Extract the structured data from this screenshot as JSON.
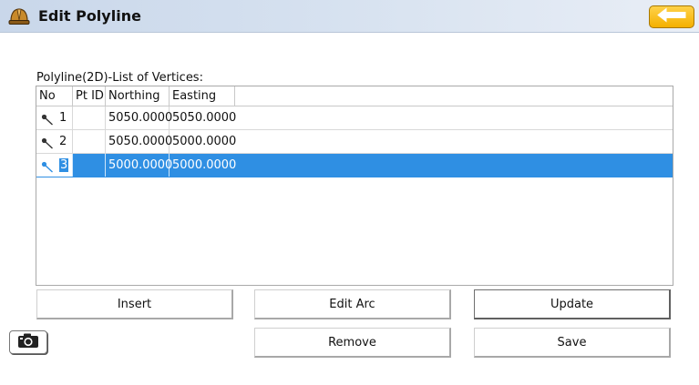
{
  "window": {
    "title": "Edit Polyline"
  },
  "list": {
    "caption": "Polyline(2D)-List of Vertices:",
    "columns": [
      "No",
      "Pt ID",
      "Northing",
      "Easting"
    ],
    "rows": [
      {
        "no": "1",
        "pt_id": "",
        "northing": "5050.0000",
        "easting": "5050.0000",
        "selected": false
      },
      {
        "no": "2",
        "pt_id": "",
        "northing": "5050.0000",
        "easting": "5000.0000",
        "selected": false
      },
      {
        "no": "3",
        "pt_id": "",
        "northing": "5000.0000",
        "easting": "5000.0000",
        "selected": true
      }
    ]
  },
  "buttons": {
    "insert": "Insert",
    "edit_arc": "Edit Arc",
    "update": "Update",
    "remove": "Remove",
    "save": "Save"
  },
  "icons": {
    "app": "hard-hat-icon",
    "back": "back-arrow-icon",
    "row": "vertex-pin-icon",
    "camera": "camera-icon"
  },
  "colors": {
    "accent_selection": "#2f8fe3",
    "back_button": "#f4b000"
  }
}
